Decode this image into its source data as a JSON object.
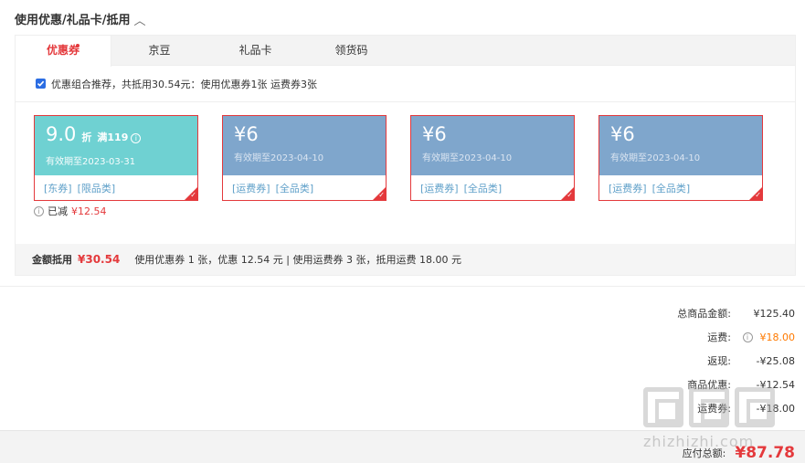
{
  "header": {
    "title": "使用优惠/礼品卡/抵用"
  },
  "tabs": [
    {
      "label": "优惠券"
    },
    {
      "label": "京豆"
    },
    {
      "label": "礼品卡"
    },
    {
      "label": "领货码"
    }
  ],
  "recommend": {
    "text": "优惠组合推荐，共抵用30.54元：使用优惠券1张 运费券3张"
  },
  "coupons": [
    {
      "value": "9.0",
      "unit": "折",
      "condition": "满119",
      "expiry": "有效期至2023-03-31",
      "tags": [
        "[东券]",
        "[限品类]"
      ]
    },
    {
      "value": "¥6",
      "expiry": "有效期至2023-04-10",
      "tags": [
        "[运费券]",
        "[全品类]"
      ]
    },
    {
      "value": "¥6",
      "expiry": "有效期至2023-04-10",
      "tags": [
        "[运费券]",
        "[全品类]"
      ]
    },
    {
      "value": "¥6",
      "expiry": "有效期至2023-04-10",
      "tags": [
        "[运费券]",
        "[全品类]"
      ]
    }
  ],
  "saved": {
    "label": "已减",
    "amount": "¥12.54"
  },
  "summary": {
    "label": "金额抵用",
    "amount": "¥30.54",
    "detail": "使用优惠券 1 张，优惠 12.54 元 | 使用运费券 3 张，抵用运费 18.00 元"
  },
  "totals": [
    {
      "label": "总商品金额:",
      "value": "¥125.40"
    },
    {
      "label": "运费:",
      "value": "¥18.00"
    },
    {
      "label": "返现:",
      "value": "-¥25.08"
    },
    {
      "label": "商品优惠:",
      "value": "-¥12.54"
    },
    {
      "label": "运费券:",
      "value": "-¥18.00"
    }
  ],
  "payable": {
    "label": "应付总额:",
    "value": "¥87.78"
  },
  "watermark": {
    "url": "zhizhizhi.com"
  },
  "colors": {
    "accent": "#e4393c",
    "teal": "#6fd1d2",
    "blue": "#7fa6cc",
    "orange": "#ff7a00"
  }
}
